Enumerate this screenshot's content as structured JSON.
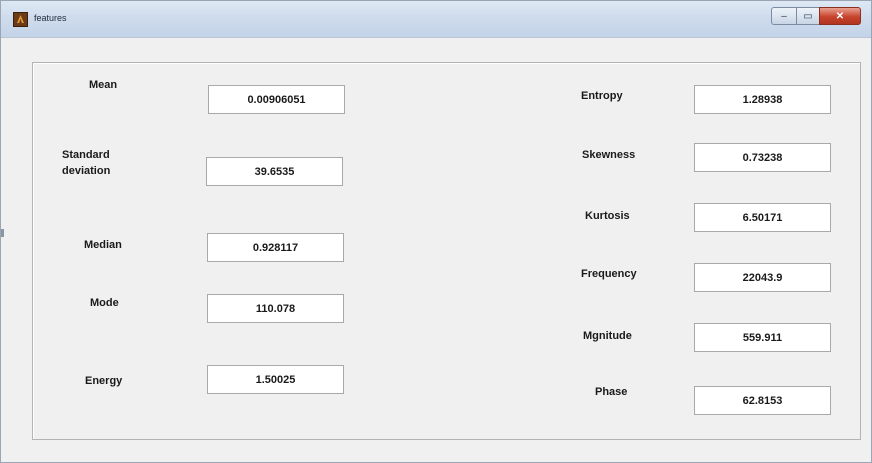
{
  "window": {
    "title": "features",
    "controls": {
      "minimize_glyph": "–",
      "maximize_glyph": "▭",
      "close_glyph": "✕"
    }
  },
  "features": {
    "mean": {
      "label": "Mean",
      "value": "0.00906051"
    },
    "standard_deviation": {
      "label_line1": "Standard",
      "label_line2": "deviation",
      "value": "39.6535"
    },
    "median": {
      "label": "Median",
      "value": "0.928117"
    },
    "mode": {
      "label": "Mode",
      "value": "110.078"
    },
    "energy": {
      "label": "Energy",
      "value": "1.50025"
    },
    "entropy": {
      "label": "Entropy",
      "value": "1.28938"
    },
    "skewness": {
      "label": "Skewness",
      "value": "0.73238"
    },
    "kurtosis": {
      "label": "Kurtosis",
      "value": "6.50171"
    },
    "frequency": {
      "label": "Frequency",
      "value": "22043.9"
    },
    "magnitude": {
      "label": "Mgnitude",
      "value": "559.911"
    },
    "phase": {
      "label": "Phase",
      "value": "62.8153"
    }
  },
  "colors": {
    "titlebar": "#cfdced",
    "window_bg": "#f0f0f0",
    "close_button": "#c7442d",
    "field_bg": "#ffffff"
  }
}
